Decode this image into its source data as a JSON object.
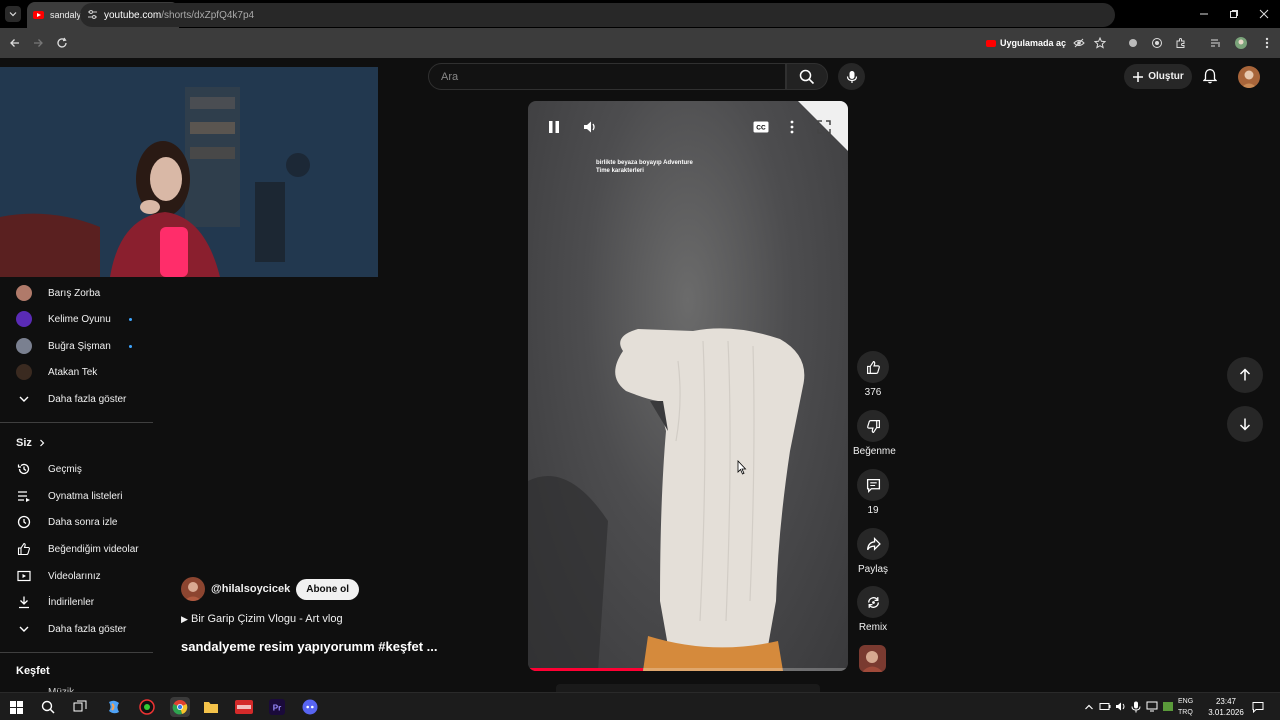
{
  "browser": {
    "tab_title": "sandalyeme resim yapıyorum",
    "url_domain": "youtube.com",
    "url_path": "/shorts/dxZpfQ4k7p4",
    "open_in_app": "Uygulamada aç"
  },
  "header": {
    "search_placeholder": "Ara",
    "create_label": "Oluştur"
  },
  "sidebar": {
    "subscriptions": [
      {
        "name": "Barış Zorba",
        "new": false
      },
      {
        "name": "Kelime Oyunu",
        "new": true
      },
      {
        "name": "Buğra Şişman",
        "new": true
      },
      {
        "name": "Atakan Tek",
        "new": false
      }
    ],
    "show_more_subs": "Daha fazla göster",
    "you_section": "Siz",
    "you_items": [
      {
        "label": "Geçmiş",
        "icon": "history-icon"
      },
      {
        "label": "Oynatma listeleri",
        "icon": "playlist-icon"
      },
      {
        "label": "Daha sonra izle",
        "icon": "clock-icon"
      },
      {
        "label": "Beğendiğim videolar",
        "icon": "thumb-up-icon"
      },
      {
        "label": "Videolarınız",
        "icon": "video-icon"
      },
      {
        "label": "İndirilenler",
        "icon": "download-icon"
      }
    ],
    "show_more_you": "Daha fazla göster",
    "explore_section": "Keşfet",
    "explore_first": "Müzik"
  },
  "video": {
    "caption": "birlikte beyaza boyayıp Adventure Time karakterleri",
    "progress": 0.36,
    "channel": "@hilalsoycicek",
    "subscribe_label": "Abone ol",
    "playlist": "Bir Garip Çizim Vlogu - Art vlog",
    "title": "sandalyeme resim yapıyorumm #keşfet ..."
  },
  "actions": {
    "likes": "376",
    "dislike_label": "Beğenme",
    "comments": "19",
    "share_label": "Paylaş",
    "remix_label": "Remix"
  },
  "taskbar": {
    "lang_1": "ENG",
    "lang_2": "TRQ",
    "time": "23:47",
    "date": "3.01.2026"
  },
  "colors": {
    "accent": "#ff0033",
    "background": "#0f0f0f",
    "link_blue": "#3ea6ff"
  }
}
